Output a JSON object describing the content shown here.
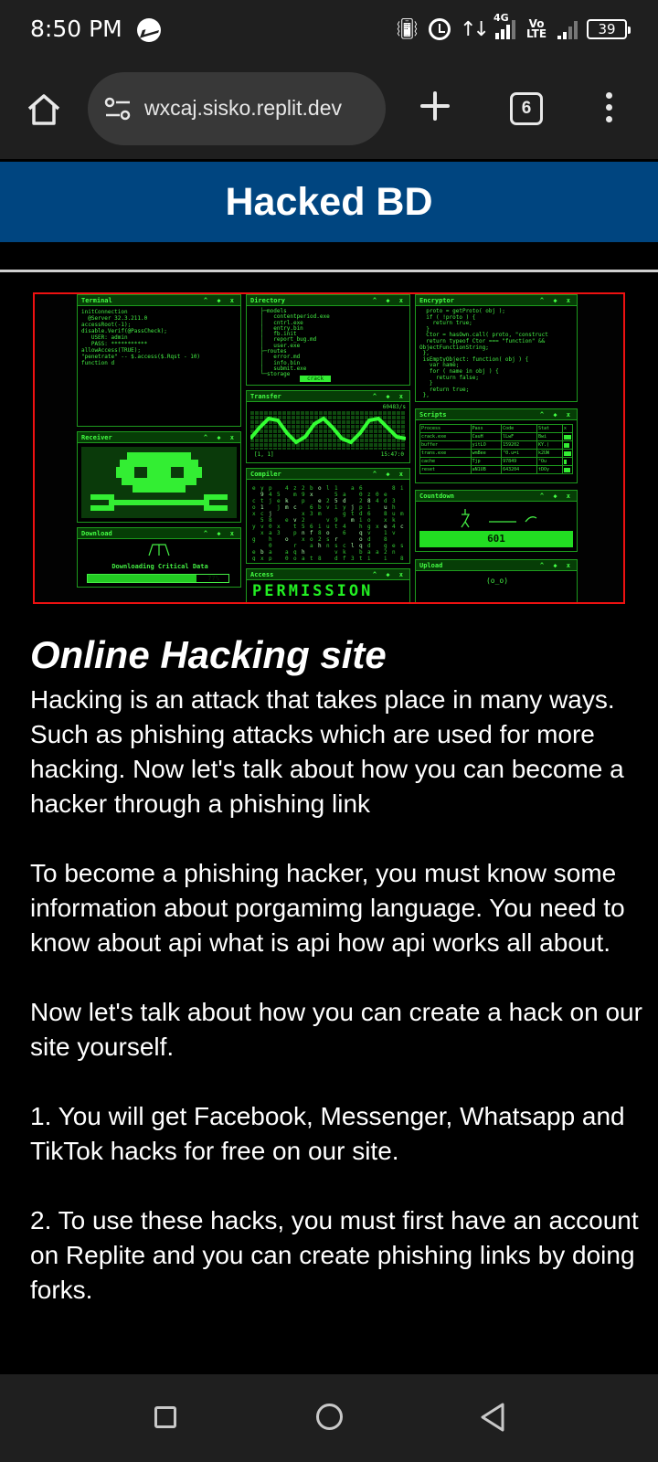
{
  "status_bar": {
    "time": "8:50 PM",
    "network_tag": "4G",
    "volte": "Vo LTE",
    "battery": "39"
  },
  "browser": {
    "url": "wxcaj.sisko.replit.dev",
    "tab_count": "6"
  },
  "page": {
    "header_title": "Hacked BD",
    "title": "Online Hacking site",
    "paragraphs": [
      "Hacking is an attack that takes place in many ways. Such as phishing attacks which are used for more hacking. Now let's talk about how you can become a hacker through a phishing link",
      "To become a phishing hacker, you must know some information about porgamimg language. You need to know about api what is api how api works all about.",
      "Now let's talk about how you can create a hack on our site yourself.",
      "1. You will get Facebook, Messenger, Whatsapp and TikTok hacks for free on our site.",
      "2. To use these hacks, you must first have an account on Replite and you can create phishing links by doing forks."
    ]
  },
  "hero_image": {
    "panels": {
      "terminal": "Terminal",
      "directory": "Directory",
      "encryptor": "Encryptor",
      "transfer": "Transfer",
      "receiver": "Receiver",
      "scripts": "Scripts",
      "compiler": "Compiler",
      "countdown": "Countdown",
      "download": "Download",
      "access": "Access",
      "upload": "Upload"
    },
    "terminal_text": "initConnection\n  @Server 32.3.211.0\naccessRoot(-1);\ndisable.Verif(@PassCheck);\n   USER: admin\n   PASS: ***********\nallowAccess(TRUE);\n\"penetrate\" -- $.access($.Rqst - 10)\nfunction d",
    "directory_text": "   ├─models\n   │   contentperiod.exe\n   │   cntrl.exe\n   │   entry.bin\n   │   fb.init\n   │   report_bug.md\n   │   user.exe\n   ├─routes\n   │   error.md\n   │   info.bin\n   │   submit.exe\n   └─storage",
    "directory_badge": "crack",
    "encryptor_text": "  proto = getProto( obj );\n  if ( !proto ) {\n    return true;\n  }\n  Ctor = hasOwn.call( proto, \"construct\n  return typeof Ctor === \"function\" &&\nObjectFunctionString;\n },\n isEmptyObject: function( obj ) {\n   var name;\n   for ( name in obj ) {\n     return false;\n   }\n   return true;\n },",
    "transfer_rate": "60483/s",
    "transfer_left": "[1, 1]",
    "transfer_right": "15:47:0",
    "scripts_headers": [
      "Process",
      "Pass",
      "Code",
      "Stat",
      "x"
    ],
    "scripts_rows": [
      [
        "crack.exe",
        "CauH",
        "lLwF",
        "Bwi"
      ],
      [
        "buffer",
        "yitLO",
        "159202",
        "KY.("
      ],
      [
        "trans.exe",
        "wmBee",
        "\"0.u=i",
        "k2UW"
      ],
      [
        "cache",
        "Tjp",
        "97849",
        "\"Ou"
      ],
      [
        "reset",
        "aN1UB",
        "643204",
        "tDOy"
      ]
    ],
    "countdown_value": "601",
    "download_label": "Downloading Critical Data",
    "download_percent": "77%",
    "download_progress": 0.77,
    "access_text": "PERMISSION",
    "upload_icon": "(o_o)"
  }
}
